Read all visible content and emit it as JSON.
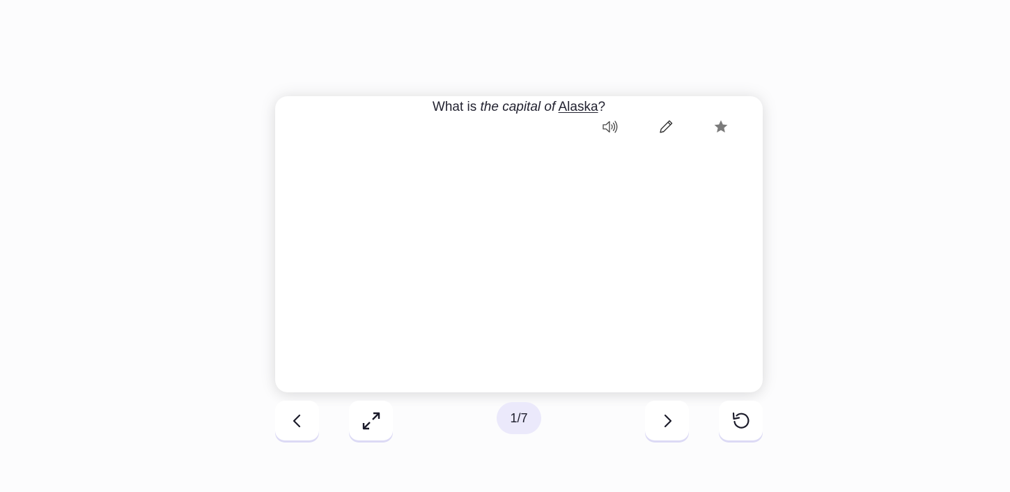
{
  "card": {
    "question_parts": [
      "What is ",
      "the capital of",
      " ",
      "Alaska",
      "?"
    ],
    "icons": {
      "audio": "speaker-icon",
      "edit": "pencil-icon",
      "favorite": "star-icon"
    }
  },
  "controls": {
    "prev": "chevron-left-icon",
    "expand": "expand-icon",
    "counter": "1/7",
    "next": "chevron-right-icon",
    "reset": "reset-icon"
  },
  "colors": {
    "background": "#fcfcfd",
    "accent_light": "#ebe9fb",
    "button_shadow": "#dcdaf5",
    "icon_gray": "#7b7b7b"
  }
}
